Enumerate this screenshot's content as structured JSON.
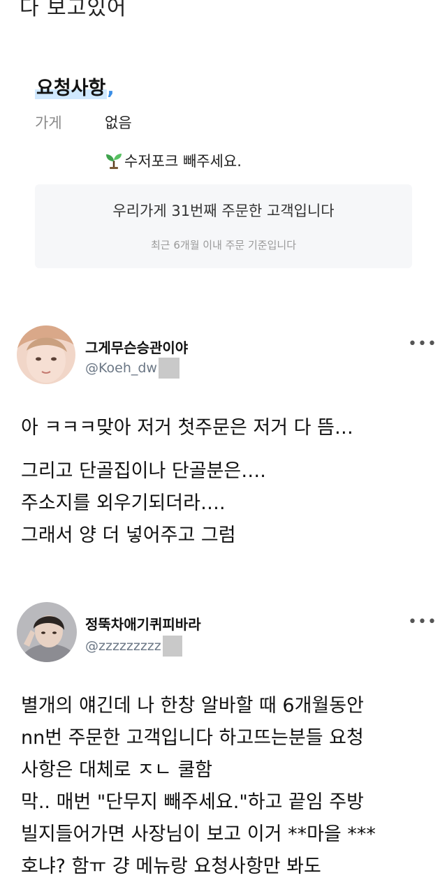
{
  "top_cut_text": "다 보고있어",
  "request_section": {
    "title": "요청사항",
    "store_label": "가게",
    "store_value": "없음",
    "request_text": "수저포크 빼주세요.",
    "order_count_main": "우리가게 31번째 주문한 고객입니다",
    "order_count_sub": "최근 6개월 이내 주문 기준입니다"
  },
  "tweets": [
    {
      "name": "그게무슨승관이야",
      "handle": "@Koeh_dw",
      "more_label": "•••",
      "lines": [
        "아 ㅋㅋㅋ맞아 저거 첫주문은 저거 다 뜸…",
        "그리고 단골집이나 단골분은….",
        "주소지를 외우기되더라….",
        "그래서 양 더 넣어주고 그럼"
      ]
    },
    {
      "name": "정뚝차애기퀴피바라",
      "handle": "@zzzzzzzzz",
      "more_label": "•••",
      "lines": [
        "별개의 얘긴데 나 한창 알바할 때 6개월동안",
        "nn번 주문한 고객입니다 하고뜨는분들 요청",
        "사항은 대체로 ㅈㄴ 쿨함",
        "막.. 매번 \"단무지 빼주세요.\"하고 끝임 주방",
        "빌지들어가면 사장님이 보고 이거 **마을 ***",
        "호냐? 함ㅠ 걍 메뉴랑 요청사항만 봐도"
      ]
    }
  ]
}
